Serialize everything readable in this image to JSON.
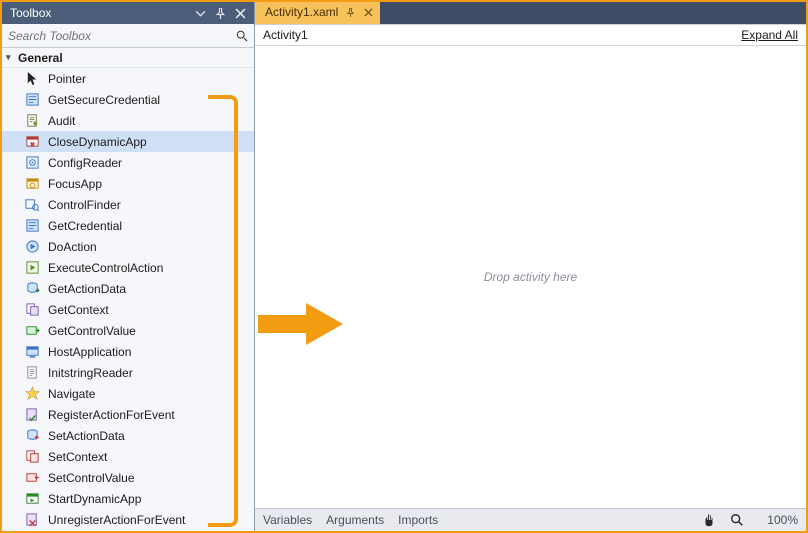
{
  "toolbox": {
    "title": "Toolbox",
    "search_placeholder": "Search Toolbox",
    "group": "General",
    "items": [
      {
        "label": "Pointer",
        "icon": "pointer"
      },
      {
        "label": "GetSecureCredential",
        "icon": "form"
      },
      {
        "label": "Audit",
        "icon": "audit"
      },
      {
        "label": "CloseDynamicApp",
        "icon": "close-app",
        "selected": true
      },
      {
        "label": "ConfigReader",
        "icon": "config"
      },
      {
        "label": "FocusApp",
        "icon": "focus"
      },
      {
        "label": "ControlFinder",
        "icon": "finder"
      },
      {
        "label": "GetCredential",
        "icon": "form"
      },
      {
        "label": "DoAction",
        "icon": "action"
      },
      {
        "label": "ExecuteControlAction",
        "icon": "exec"
      },
      {
        "label": "GetActionData",
        "icon": "getdata"
      },
      {
        "label": "GetContext",
        "icon": "context"
      },
      {
        "label": "GetControlValue",
        "icon": "getval"
      },
      {
        "label": "HostApplication",
        "icon": "host"
      },
      {
        "label": "InitstringReader",
        "icon": "init"
      },
      {
        "label": "Navigate",
        "icon": "nav"
      },
      {
        "label": "RegisterActionForEvent",
        "icon": "register"
      },
      {
        "label": "SetActionData",
        "icon": "setdata"
      },
      {
        "label": "SetContext",
        "icon": "setctx"
      },
      {
        "label": "SetControlValue",
        "icon": "setval"
      },
      {
        "label": "StartDynamicApp",
        "icon": "start"
      },
      {
        "label": "UnregisterActionForEvent",
        "icon": "unreg"
      }
    ]
  },
  "designer": {
    "tab_label": "Activity1.xaml",
    "breadcrumb": "Activity1",
    "expand_label": "Expand All",
    "drop_hint": "Drop activity here",
    "bottom": {
      "variables": "Variables",
      "arguments": "Arguments",
      "imports": "Imports",
      "zoom": "100%"
    }
  },
  "colors": {
    "accent": "#f39c12",
    "tab_active": "#f7c15c",
    "header": "#4b5d78"
  }
}
